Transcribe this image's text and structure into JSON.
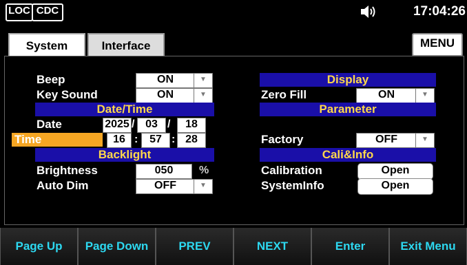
{
  "status": {
    "loc": "LOC",
    "cdc": "CDC",
    "volume_icon": "speaker-volume-icon",
    "time": "17:04:26"
  },
  "tabs": [
    {
      "label": "System",
      "active": true
    },
    {
      "label": "Interface",
      "active": false
    }
  ],
  "menu_label": "MENU",
  "left": {
    "beep": {
      "label": "Beep",
      "value": "ON"
    },
    "key_sound": {
      "label": "Key Sound",
      "value": "ON"
    },
    "datetime_header": "Date/Time",
    "date": {
      "label": "Date",
      "year": "2025",
      "month": "03",
      "day": "18"
    },
    "time": {
      "label": "Time",
      "hour": "16",
      "minute": "57",
      "second": "28"
    },
    "backlight_header": "Backlight",
    "brightness": {
      "label": "Brightness",
      "value": "050",
      "unit": "%"
    },
    "auto_dim": {
      "label": "Auto Dim",
      "value": "OFF"
    }
  },
  "right": {
    "display_header": "Display",
    "zero_fill": {
      "label": "Zero Fill",
      "value": "ON"
    },
    "parameter_header": "Parameter",
    "factory": {
      "label": "Factory",
      "value": "OFF"
    },
    "cali_header": "Cali&Info",
    "calibration": {
      "label": "Calibration",
      "button": "Open"
    },
    "systeminfo": {
      "label": "SystemInfo",
      "button": "Open"
    }
  },
  "softkeys": [
    "Page Up",
    "Page Down",
    "PREV",
    "NEXT",
    "Enter",
    "Exit Menu"
  ],
  "colors": {
    "header_bg": "#1a0fa8",
    "header_text": "#ffd84a",
    "highlight": "#f6a623",
    "softkey_text": "#2dd8f0"
  }
}
